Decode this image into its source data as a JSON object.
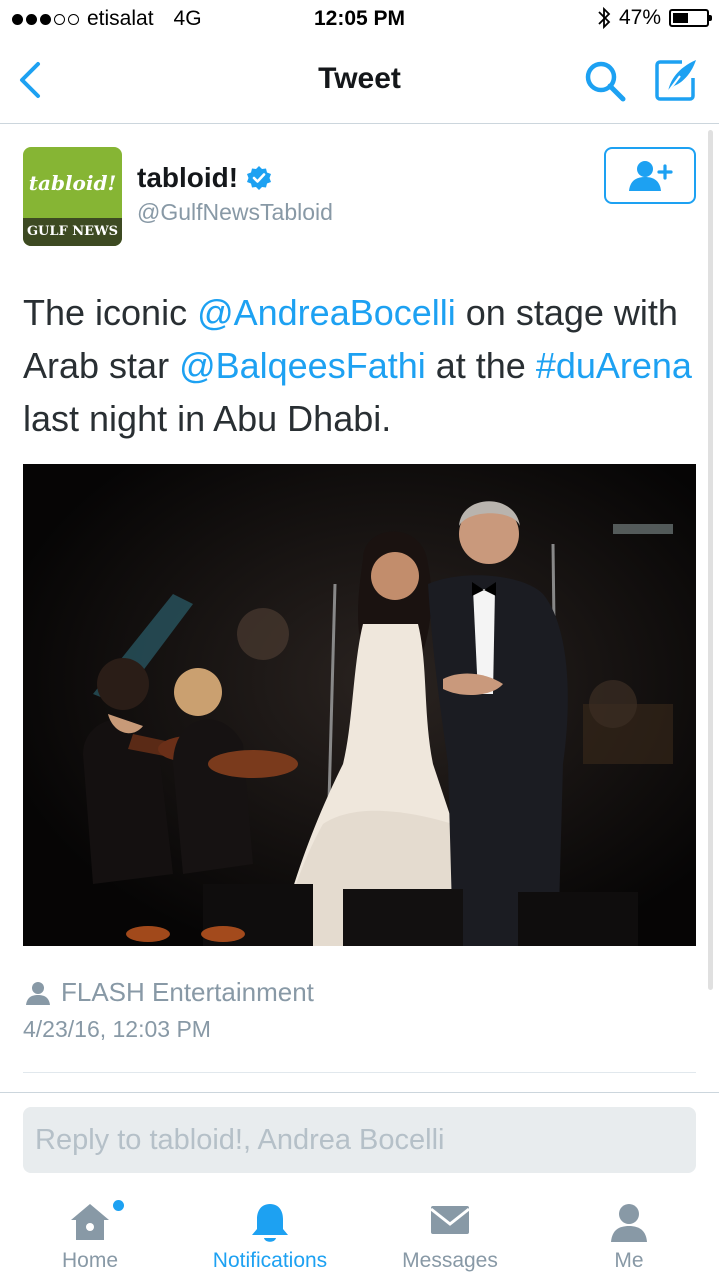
{
  "status_bar": {
    "carrier": "etisalat",
    "network": "4G",
    "time": "12:05 PM",
    "battery": "47%",
    "battery_level": 0.47,
    "signal_bars": 3
  },
  "nav": {
    "title": "Tweet"
  },
  "tweet": {
    "display_name": "tabloid!",
    "handle": "@GulfNewsTabloid",
    "avatar_logo_text": "tabloid!",
    "avatar_band_text": "GULF NEWS",
    "text_parts": {
      "p1": "The iconic ",
      "mention1": "@AndreaBocelli",
      "p2": " on stage with Arab star ",
      "mention2": "@BalqeesFathi",
      "p3": " at the ",
      "hashtag": "#duArena",
      "p4": " last night in Abu Dhabi."
    },
    "media_credit": "FLASH Entertainment",
    "timestamp": "4/23/16, 12:03 PM"
  },
  "reply": {
    "placeholder": "Reply to tabloid!, Andrea Bocelli"
  },
  "tabs": [
    {
      "label": "Home",
      "icon": "home-icon",
      "active": false,
      "badge": true
    },
    {
      "label": "Notifications",
      "icon": "bell-icon",
      "active": true
    },
    {
      "label": "Messages",
      "icon": "envelope-icon",
      "active": false
    },
    {
      "label": "Me",
      "icon": "person-icon",
      "active": false
    }
  ],
  "colors": {
    "accent": "#1da1f2",
    "muted": "#8899a6",
    "text": "#292f33",
    "avatar_green": "#86b534"
  }
}
